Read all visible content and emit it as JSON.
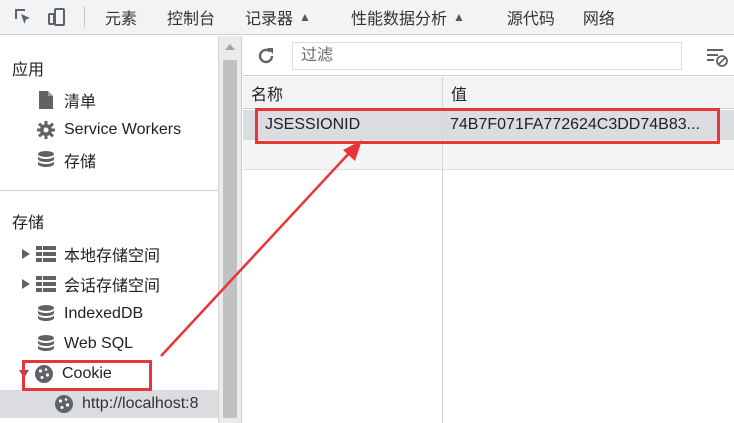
{
  "toolbar": {
    "tabs": [
      {
        "label": "元素"
      },
      {
        "label": "控制台"
      },
      {
        "label": "记录器",
        "experimental": true
      },
      {
        "label": "性能数据分析",
        "experimental": true
      },
      {
        "label": "源代码"
      },
      {
        "label": "网络"
      }
    ],
    "experimental_icon": "flask-icon"
  },
  "sidebar": {
    "app_section": {
      "title": "应用",
      "items": [
        {
          "label": "清单",
          "icon": "document-icon"
        },
        {
          "label": "Service Workers",
          "icon": "gear-icon"
        },
        {
          "label": "存储",
          "icon": "database-icon"
        }
      ]
    },
    "storage_section": {
      "title": "存储",
      "items": [
        {
          "label": "本地存储空间",
          "icon": "grid-icon",
          "expander": "collapsed"
        },
        {
          "label": "会话存储空间",
          "icon": "grid-icon",
          "expander": "collapsed"
        },
        {
          "label": "IndexedDB",
          "icon": "database-icon"
        },
        {
          "label": "Web SQL",
          "icon": "database-icon"
        },
        {
          "label": "Cookie",
          "icon": "cookie-icon",
          "expander": "expanded"
        },
        {
          "label": "http://localhost:8",
          "icon": "cookie-icon",
          "selected": true
        }
      ]
    }
  },
  "main": {
    "filter_placeholder": "过滤",
    "columns": [
      "名称",
      "值"
    ],
    "rows": [
      {
        "name": "JSESSIONID",
        "value": "74B7F071FA772624C3DD74B83..."
      }
    ]
  },
  "colors": {
    "annotation": "#e8353a",
    "selected_row": "#dadce0",
    "toolbar_bg": "#f1f3f4"
  }
}
